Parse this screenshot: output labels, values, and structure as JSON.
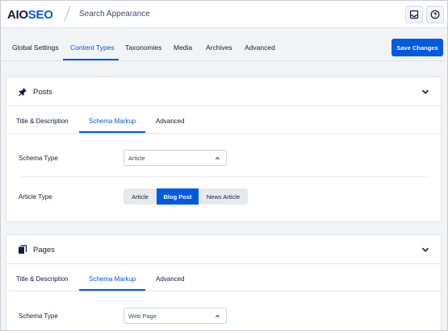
{
  "header": {
    "logo_prefix": "AIO",
    "logo_suffix": "SEO",
    "page_title": "Search Appearance"
  },
  "nav": {
    "tabs": [
      {
        "label": "Global Settings"
      },
      {
        "label": "Content Types"
      },
      {
        "label": "Taxonomies"
      },
      {
        "label": "Media"
      },
      {
        "label": "Archives"
      },
      {
        "label": "Advanced"
      }
    ],
    "active_tab": "Content Types",
    "save_label": "Save Changes"
  },
  "posts_card": {
    "title": "Posts",
    "tabs": [
      {
        "label": "Title & Description"
      },
      {
        "label": "Schema Markup"
      },
      {
        "label": "Advanced"
      }
    ],
    "active_tab": "Schema Markup",
    "schema_type_label": "Schema Type",
    "schema_type_value": "Article",
    "article_type_label": "Article Type",
    "article_type_options": [
      {
        "label": "Article"
      },
      {
        "label": "Blog Post"
      },
      {
        "label": "News Article"
      }
    ],
    "article_type_selected": "Blog Post"
  },
  "pages_card": {
    "title": "Pages",
    "tabs": [
      {
        "label": "Title & Description"
      },
      {
        "label": "Schema Markup"
      },
      {
        "label": "Advanced"
      }
    ],
    "active_tab": "Schema Markup",
    "schema_type_label": "Schema Type",
    "schema_type_value": "Web Page"
  },
  "colors": {
    "accent": "#005ae0",
    "text": "#141b38",
    "background": "#f2f3f5"
  },
  "icons": [
    "save-icon",
    "help-icon",
    "pin-icon",
    "pages-icon",
    "chevron-down-icon"
  ]
}
